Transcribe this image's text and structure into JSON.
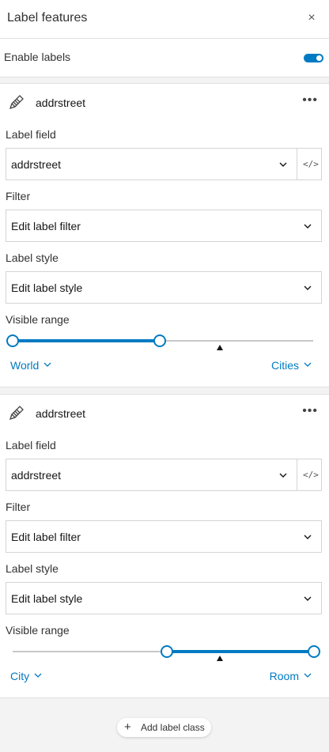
{
  "header": {
    "title": "Label features",
    "close_glyph": "×",
    "close_icon": "close-icon"
  },
  "enable": {
    "label": "Enable labels",
    "enabled": true
  },
  "cards": [
    {
      "title": "addrstreet",
      "icon": "pencil-label-icon",
      "more_glyph": "•••",
      "label_field": {
        "label": "Label field",
        "value": "addrstreet",
        "expression_glyph": "</>"
      },
      "filter": {
        "label": "Filter",
        "value": "Edit label filter"
      },
      "style": {
        "label": "Label style",
        "value": "Edit label style"
      },
      "visible_range": {
        "label": "Visible range",
        "min": "World",
        "max": "Cities"
      }
    },
    {
      "title": "addrstreet",
      "icon": "pencil-label-icon",
      "more_glyph": "•••",
      "label_field": {
        "label": "Label field",
        "value": "addrstreet",
        "expression_glyph": "</>"
      },
      "filter": {
        "label": "Filter",
        "value": "Edit label filter"
      },
      "style": {
        "label": "Label style",
        "value": "Edit label style"
      },
      "visible_range": {
        "label": "Visible range",
        "min": "City",
        "max": "Room"
      }
    }
  ],
  "add_label_class": {
    "plus": "+",
    "label": "Add label class"
  },
  "colors": {
    "accent": "#007ac2",
    "background": "#f3f3f3",
    "border": "#d4d4d4"
  }
}
